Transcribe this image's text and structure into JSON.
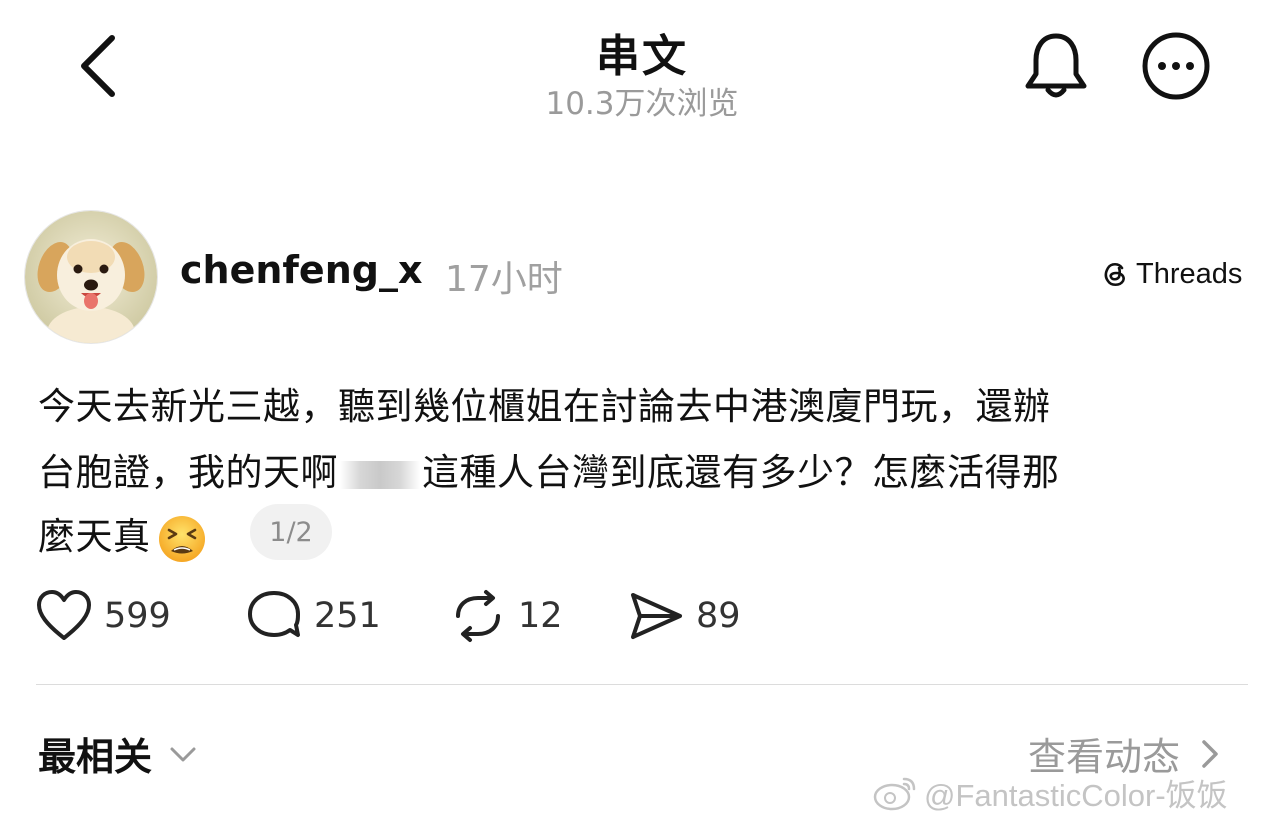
{
  "header": {
    "title": "串文",
    "views": "10.3万次浏览",
    "back_icon": "chevron-left-icon",
    "bell_icon": "bell-icon",
    "more_icon": "more-horizontal-icon"
  },
  "post": {
    "username": "chenfeng_x",
    "time": "17小时",
    "source_badge": "Threads",
    "avatar_icon": "golden-retriever-puppy-avatar",
    "text_line1": "今天去新光三越，聽到幾位櫃姐在討論去中港澳廈門玩，還辦",
    "text_line2_a": "台胞證，我的天啊",
    "text_line2_b": "這種人台灣到底還有多少？怎麼活得那",
    "text_line3": "麼天真",
    "emoji": "tired-face-emoji",
    "page_indicator": "1/2"
  },
  "actions": {
    "likes": "599",
    "comments": "251",
    "reposts": "12",
    "shares": "89"
  },
  "footer": {
    "sort_label": "最相关",
    "activity_label": "查看动态",
    "watermark": "@FantasticColor-饭饭"
  },
  "colors": {
    "text": "#111111",
    "muted": "#9a9a9a",
    "divider": "#dcdcdc",
    "pill_bg": "#f1f1f1"
  }
}
